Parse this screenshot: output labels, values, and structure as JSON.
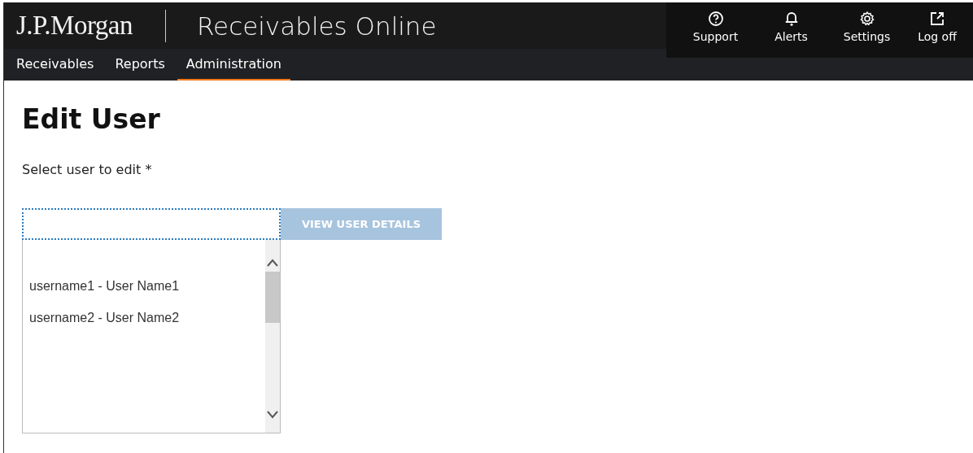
{
  "header": {
    "logo": "J.P.Morgan",
    "title": "Receivables Online",
    "utilities": [
      {
        "kind": "help",
        "label": "Support"
      },
      {
        "kind": "bell",
        "label": "Alerts"
      },
      {
        "kind": "gear",
        "label": "Settings"
      },
      {
        "kind": "exit",
        "label": "Log off"
      }
    ]
  },
  "nav": [
    {
      "label": "Receivables",
      "selected": false
    },
    {
      "label": "Reports",
      "selected": false
    },
    {
      "label": "Administration",
      "selected": true
    }
  ],
  "page": {
    "heading": "Edit User",
    "field_label": "Select user to edit *",
    "button": {
      "label": "VIEW USER DETAILS",
      "disabled": true
    },
    "options": [
      "username1 - User Name1",
      "username2 - User Name2"
    ]
  }
}
